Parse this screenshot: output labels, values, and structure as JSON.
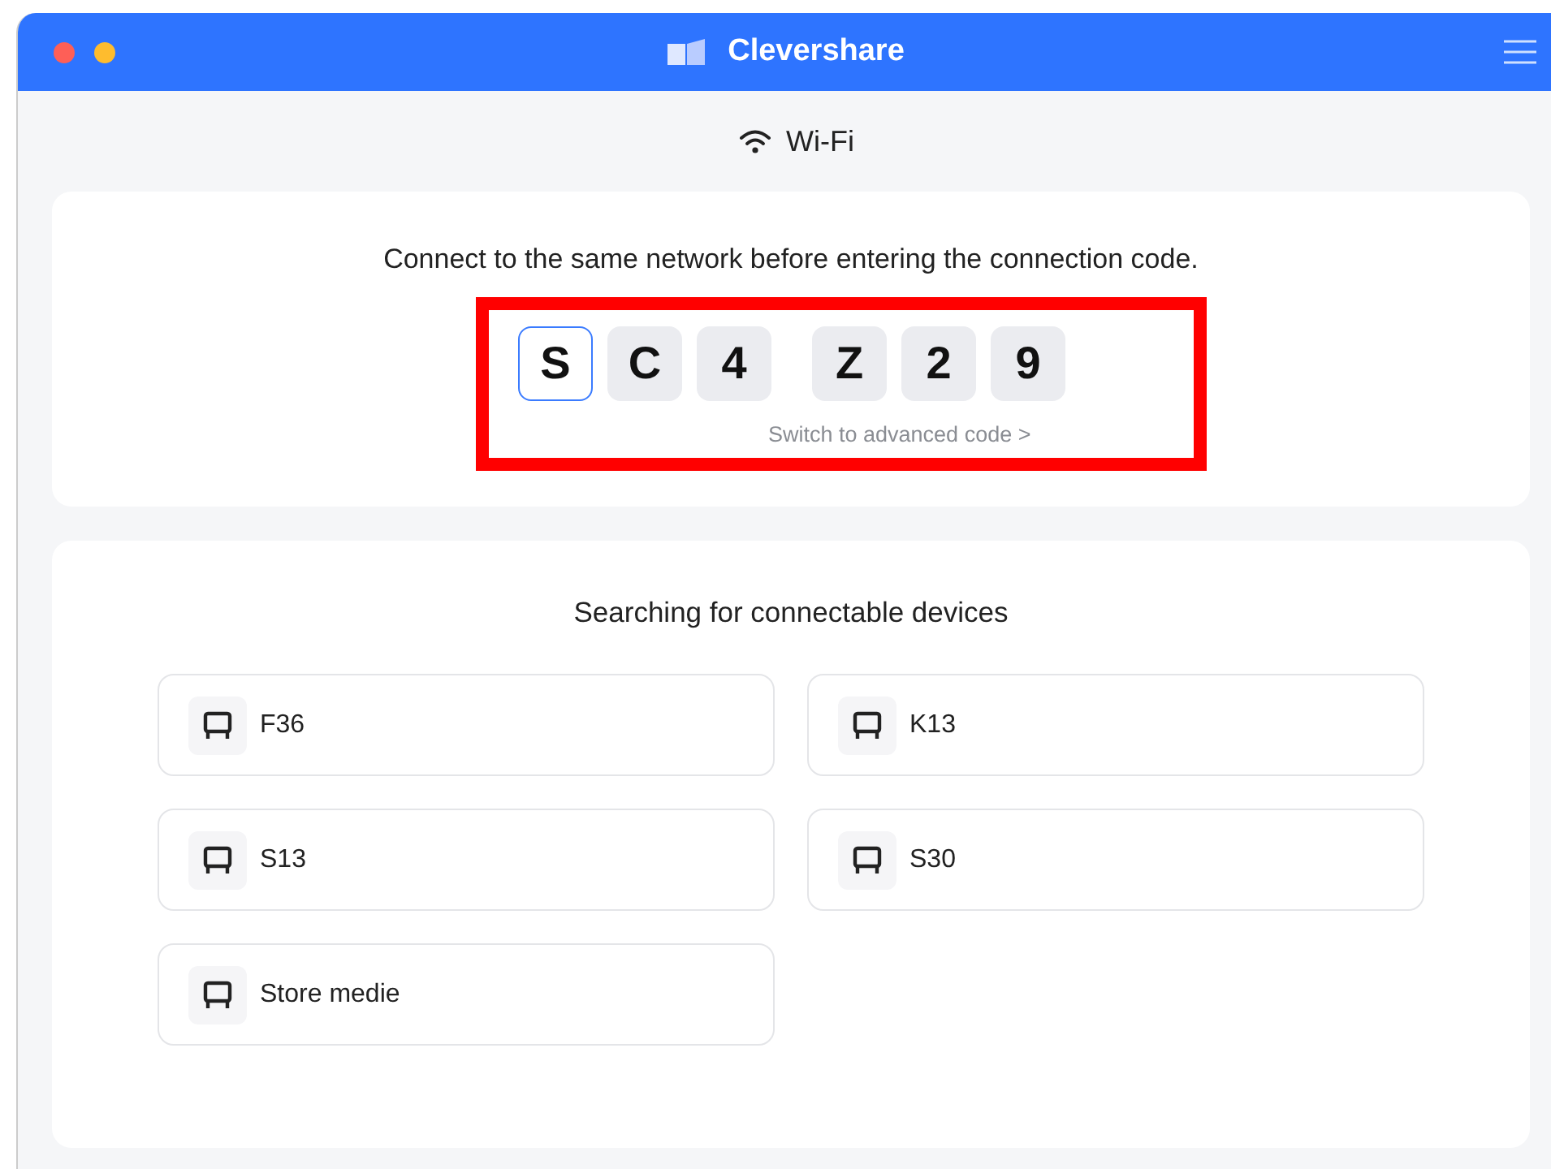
{
  "window": {
    "title": "Clevershare"
  },
  "network": {
    "label": "Wi-Fi"
  },
  "connect": {
    "instruction": "Connect to the same network before entering the connection code.",
    "code_groups": [
      [
        {
          "char": "S",
          "selected": true
        },
        {
          "char": "C",
          "selected": false
        },
        {
          "char": "4",
          "selected": false
        }
      ],
      [
        {
          "char": "Z",
          "selected": false
        },
        {
          "char": "2",
          "selected": false
        },
        {
          "char": "9",
          "selected": false
        }
      ]
    ],
    "highlighted": true,
    "advanced_link": "Switch to advanced code >"
  },
  "devices": {
    "heading": "Searching for connectable devices",
    "items": [
      {
        "name": "F36"
      },
      {
        "name": "K13"
      },
      {
        "name": "S13"
      },
      {
        "name": "S30"
      },
      {
        "name": "Store medie"
      }
    ]
  }
}
